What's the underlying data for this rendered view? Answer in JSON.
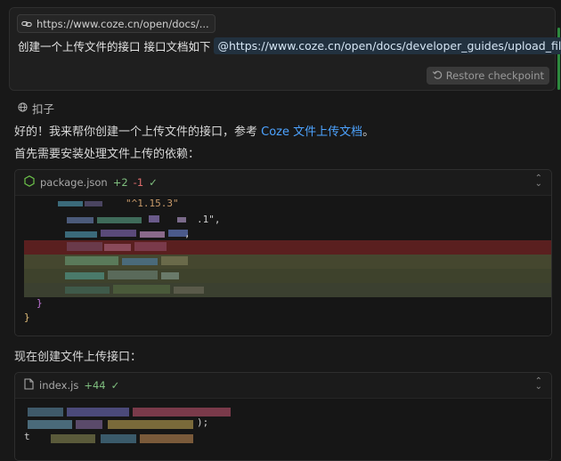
{
  "user_message": {
    "url_chip": "https://www.coze.cn/open/docs/...",
    "prompt_text": "创建一个上传文件的接口  接口文档如下",
    "mention": "@https://www.coze.cn/open/docs/developer_guides/upload_files",
    "restore_label": "Restore checkpoint"
  },
  "assistant": {
    "name": "扣子",
    "intro_prefix": "好的！我来帮你创建一个上传文件的接口，参考 ",
    "intro_link": "Coze 文件上传文档",
    "intro_suffix": "。",
    "deps_text": "首先需要安装处理文件上传的依赖：",
    "upload_text": "现在创建文件上传接口："
  },
  "files": [
    {
      "name": "package.json",
      "added": "+2",
      "removed": "-1",
      "code_visible": [
        "\"^1.15.3\"",
        ".1\",",
        ",",
        "}",
        "}"
      ]
    },
    {
      "name": "index.js",
      "added": "+44",
      "code_visible": [
        ");",
        "t"
      ]
    }
  ],
  "colors": {
    "accent_link": "#4da3ff",
    "diff_add": "#7fbf7f",
    "diff_del": "#e06c6c"
  }
}
